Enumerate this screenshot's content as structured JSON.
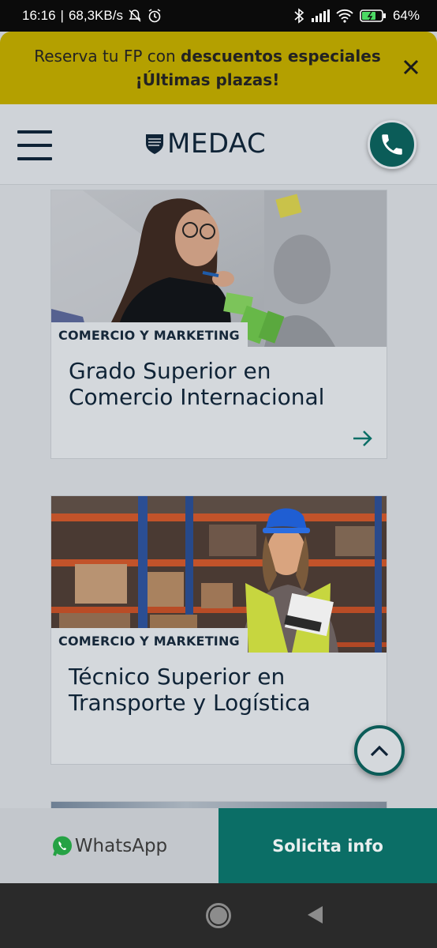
{
  "status_bar": {
    "time": "16:16",
    "speed": "68,3KB/s",
    "battery": "64%",
    "icons": [
      "bell-off-icon",
      "alarm-icon",
      "bluetooth-icon",
      "signal-icon",
      "wifi-icon",
      "battery-icon"
    ]
  },
  "promo": {
    "text_normal_1": "Reserva tu FP con ",
    "text_bold_1": "descuentos especiales",
    "text_bold_2": "¡Últimas plazas!",
    "bg_color": "#b4a000"
  },
  "header": {
    "logo_text": "MEDAC",
    "menu_icon": "hamburger-icon",
    "phone_icon": "phone-icon"
  },
  "cards": [
    {
      "category": "COMERCIO Y MARKETING",
      "title_line1": "Grado Superior en",
      "title_line2": "Comercio Internacional"
    },
    {
      "category": "COMERCIO Y MARKETING",
      "title_line1": "Técnico Superior en",
      "title_line2": "Transporte y Logística"
    }
  ],
  "cta": {
    "whatsapp_label": "WhatsApp",
    "info_label": "Solicita info",
    "accent": "#0b6e66"
  }
}
